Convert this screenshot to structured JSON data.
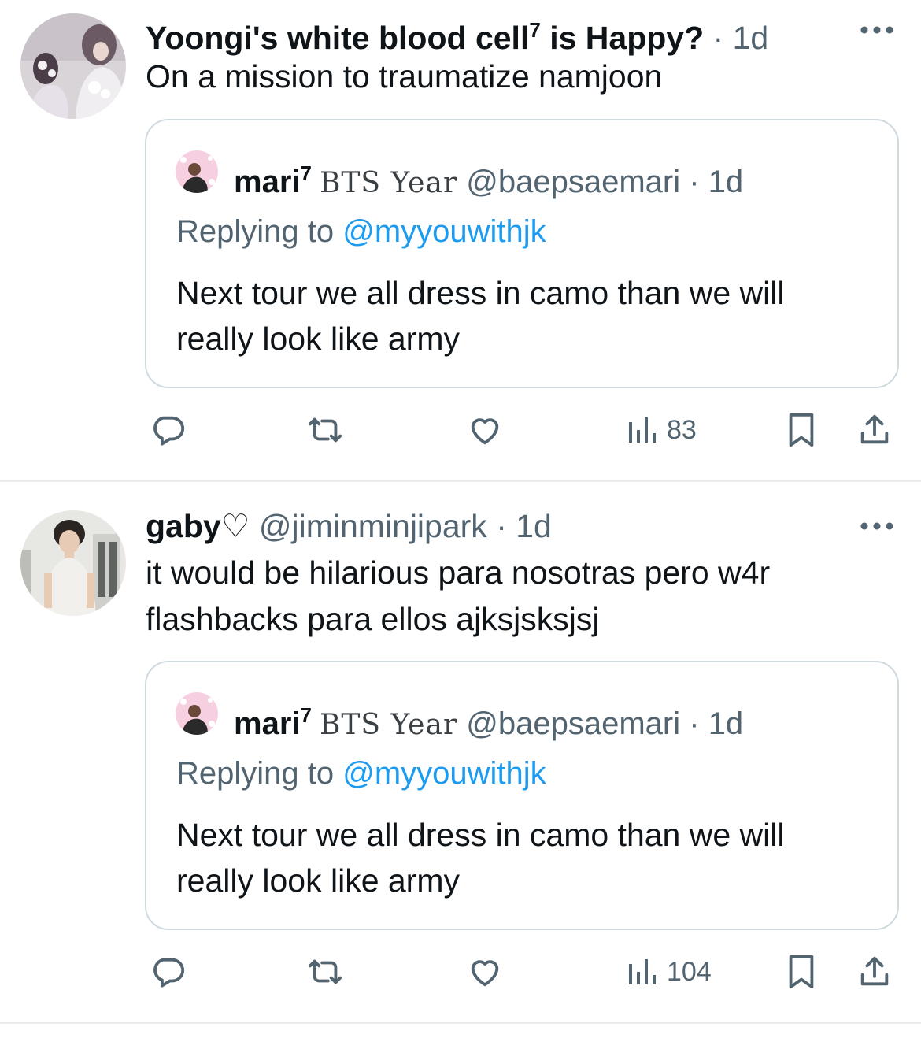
{
  "tweets": [
    {
      "display_name": "Yoongi's white blood cell",
      "name_superscript": "7",
      "name_suffix": " is Happy?",
      "handle": "",
      "separator": " · ",
      "time": "1d",
      "text": "On a mission to traumatize namjoon",
      "quote": {
        "name": "mari",
        "name_superscript": "7",
        "name_badge": "BTS Year",
        "handle": "@baepsaemari",
        "separator": " · ",
        "time": "1d",
        "replying_label": "Replying to ",
        "replying_handle": "@myyouwithjk",
        "text": "Next tour we all dress in camo than we will really look like army"
      },
      "views": "83"
    },
    {
      "display_name": "gaby♡",
      "name_superscript": "",
      "name_suffix": "",
      "handle": "@jiminminjipark",
      "separator": " · ",
      "time": "1d",
      "text": "it would be hilarious para nosotras pero w4r flashbacks para ellos ajksjsksjsj",
      "quote": {
        "name": "mari",
        "name_superscript": "7",
        "name_badge": "BTS Year",
        "handle": "@baepsaemari",
        "separator": " · ",
        "time": "1d",
        "replying_label": "Replying to ",
        "replying_handle": "@myyouwithjk",
        "text": "Next tour we all dress in camo than we will really look like army"
      },
      "views": "104"
    }
  ],
  "icons": {
    "reply": "reply-icon",
    "retweet": "retweet-icon",
    "like": "heart-icon",
    "views": "views-icon",
    "bookmark": "bookmark-icon",
    "share": "share-icon",
    "more": "more-icon"
  },
  "colors": {
    "text": "#0f1419",
    "muted": "#536471",
    "link": "#1d9bf0",
    "border": "#cfd9de"
  }
}
